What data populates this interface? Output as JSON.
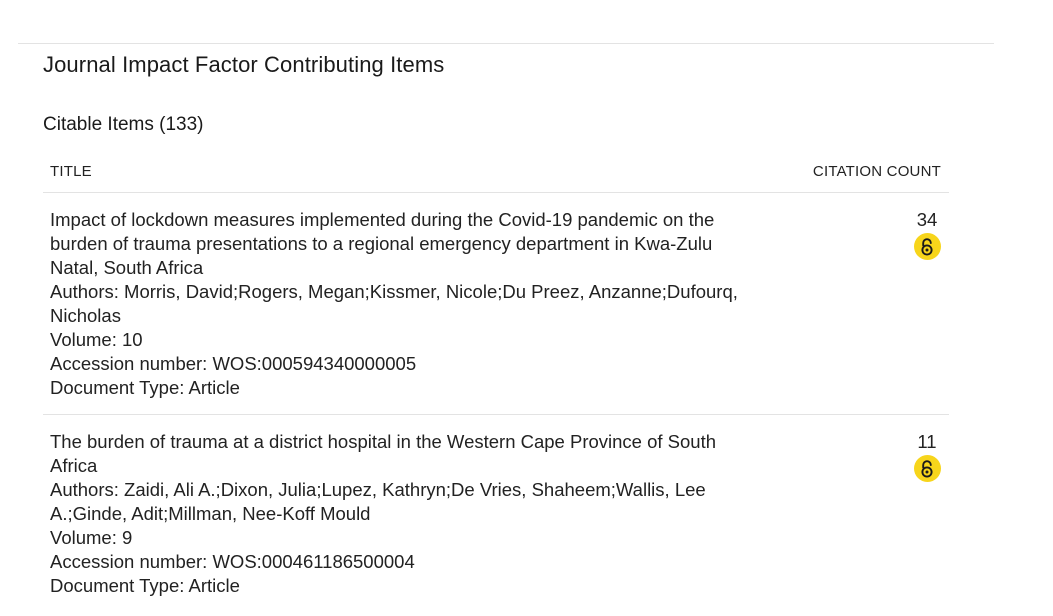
{
  "section": {
    "title": "Journal Impact Factor Contributing Items"
  },
  "citable": {
    "title": "Citable Items (133)"
  },
  "table": {
    "col_title": "TITLE",
    "col_count": "CITATION COUNT",
    "rows": [
      {
        "title": "Impact of lockdown measures implemented during the Covid-19 pandemic on the burden of trauma presentations to a regional emergency department in Kwa-Zulu Natal, South Africa",
        "authors": "Authors: Morris, David;Rogers, Megan;Kissmer, Nicole;Du Preez, Anzanne;Dufourq, Nicholas",
        "volume": "Volume: 10",
        "accession": "Accession number: WOS:000594340000005",
        "doctype": "Document Type: Article",
        "count": "34",
        "open_access_icon": "open-access-icon"
      },
      {
        "title": "The burden of trauma at a district hospital in the Western Cape Province of South Africa",
        "authors": "Authors: Zaidi, Ali A.;Dixon, Julia;Lupez, Kathryn;De Vries, Shaheem;Wallis, Lee A.;Ginde, Adit;Millman, Nee-Koff Mould",
        "volume": "Volume: 9",
        "accession": "Accession number: WOS:000461186500004",
        "doctype": "Document Type: Article",
        "count": "11",
        "open_access_icon": "open-access-icon"
      }
    ]
  },
  "colors": {
    "oa_badge": "#f7d51b",
    "divider": "#e3e3e3"
  }
}
